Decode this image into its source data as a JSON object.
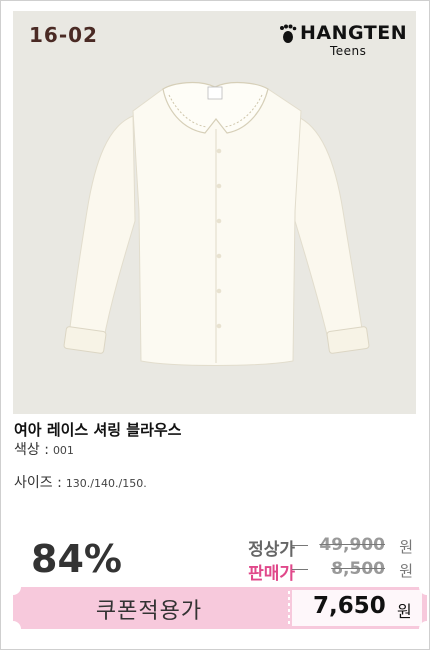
{
  "product": {
    "code": "16-02",
    "brand_name": "HANGTEN",
    "brand_sub": "Teens",
    "name": "여아 레이스 셔링 블라우스",
    "color_label": "색상 :",
    "color_value": "001",
    "size_label": "사이즈 :",
    "size_value": "130./140./150."
  },
  "pricing": {
    "discount": "84%",
    "regular_label": "정상가",
    "regular_price": "49,900",
    "sale_label": "판매가",
    "sale_price": "8,500",
    "currency": "원",
    "coupon_label": "쿠폰적용가",
    "coupon_price": "7,650",
    "coupon_currency": "원"
  },
  "colors": {
    "photo_bg": "#e9e8e2",
    "sale_label": "#e0488a",
    "coupon_bg": "#f7c9dc",
    "code_text": "#4a2a24"
  },
  "icons": {
    "brand_logo": "footprint-icon",
    "product_image": "white-lace-collar-blouse"
  }
}
